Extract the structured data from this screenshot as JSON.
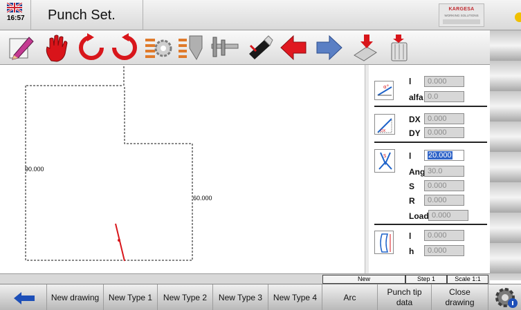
{
  "header": {
    "title": "Punch Set.",
    "time": "16:57",
    "brand": "KARGESA",
    "brand_subtitle": "WORKING SOLUTIONS",
    "flag_icon": "uk-flag-icon"
  },
  "toolbar": {
    "tools": [
      {
        "name": "edit-pencil-icon"
      },
      {
        "name": "hand-stop-icon"
      },
      {
        "name": "rotate-left-icon"
      },
      {
        "name": "rotate-right-icon"
      },
      {
        "name": "settings-list-icon"
      },
      {
        "name": "tool-list-icon"
      },
      {
        "name": "caliper-icon"
      },
      {
        "name": "usb-drive-icon"
      },
      {
        "name": "arrow-left-red-icon"
      },
      {
        "name": "arrow-right-blue-icon"
      },
      {
        "name": "pen-drive-import-icon"
      },
      {
        "name": "trash-bin-icon"
      }
    ]
  },
  "drawing": {
    "left_label": "90.000",
    "right_label": "60.000"
  },
  "panel": {
    "angle_group": {
      "l_label": "l",
      "l_value": "0.000",
      "alfa_label": "alfa",
      "alfa_value": "0.0"
    },
    "offset_group": {
      "dx_label": "DX",
      "dx_value": "0.000",
      "dy_label": "DY",
      "dy_value": "0.000"
    },
    "punch_group": {
      "l_label": "l",
      "l_value": "20.000",
      "ang_label": "Ang",
      "ang_value": "30.0",
      "s_label": "S",
      "s_value": "0.000",
      "r_label": "R",
      "r_value": "0.000",
      "load_label": "Load",
      "load_value": "0.000"
    },
    "height_group": {
      "l_label": "l",
      "l_value": "0.000",
      "h_label": "h",
      "h_value": "0.000"
    }
  },
  "status": {
    "mode": "New",
    "step": "Step 1",
    "scale": "Scale 1:1"
  },
  "fkeys": {
    "new_drawing": "New drawing",
    "new_type1": "New Type 1",
    "new_type2": "New Type 2",
    "new_type3": "New Type 3",
    "new_type4": "New Type 4",
    "arc": "Arc",
    "punch_tip_line1": "Punch tip",
    "punch_tip_line2": "data",
    "close_line1": "Close",
    "close_line2": "drawing"
  },
  "colors": {
    "accent_red": "#d8161b",
    "accent_blue": "#1d62c9",
    "highlight": "#2f64c8"
  }
}
